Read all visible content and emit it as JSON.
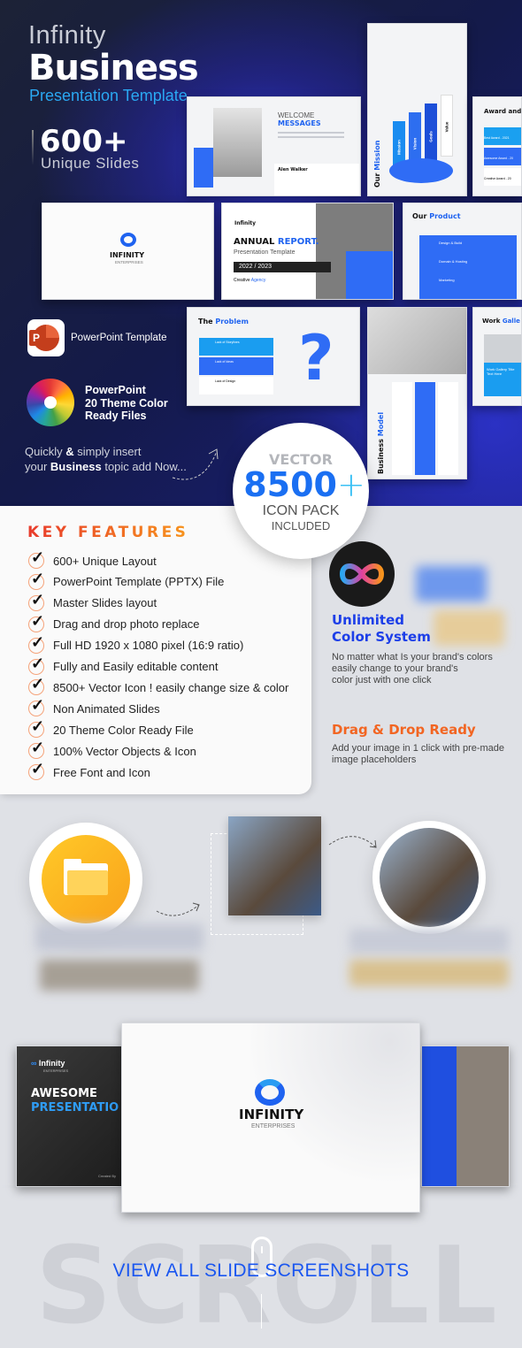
{
  "hero": {
    "brand": "Infinity",
    "title": "Business",
    "subtitle": "Presentation Template.",
    "count": "600+",
    "count_label": "Unique Slides",
    "ppt_label": "PowerPoint Template",
    "theme_label": [
      "PowerPoint",
      "20 Theme Color",
      "Ready Files"
    ],
    "tagline_1_pre": "Quickly ",
    "tagline_1_amp": "&",
    "tagline_1_post": " simply insert",
    "tagline_2_pre": "your ",
    "tagline_2_bold": "Business",
    "tagline_2_post": " topic add Now..."
  },
  "slides": {
    "welcome": {
      "line1": "WELCOME",
      "line2": "MESSAGES",
      "name": "Alen Walker",
      "side": "WELCOME"
    },
    "mission": {
      "title_a": "Our",
      "title_b": "Mission",
      "arrows": [
        "Mission",
        "Vision",
        "Goals",
        "Value"
      ]
    },
    "award": {
      "title": "Award and",
      "items": [
        "Best Award - 2021",
        "Awesome Award - 20",
        "Creative Award - 20"
      ]
    },
    "logo": {
      "name": "INFINITY",
      "sub": "ENTERPRISES"
    },
    "annual": {
      "brand": "Infinity",
      "brand_sub": "ENTERPRISES",
      "title_a": "ANNUAL",
      "title_b": "REPORT.",
      "subtitle": "Presentation Template",
      "years": "2022 / 2023",
      "agency_a": "Creative",
      "agency_b": "Agency"
    },
    "product": {
      "title_a": "Our",
      "title_b": "Product",
      "items": [
        "Design & Build",
        "Domain & Hosting",
        "Marketing"
      ]
    },
    "problem": {
      "title_a": "The",
      "title_b": "Problem",
      "items": [
        "Lack of Storylines",
        "Lack of Ideas",
        "Lack of Design"
      ]
    },
    "business_model": {
      "title_a": "Business",
      "title_b": "Model"
    },
    "gallery": {
      "title_a": "Work",
      "title_b": "Galle",
      "caption": "Work Gallery Title Text Here"
    }
  },
  "vector_badge": {
    "top": "VECTOR",
    "number": "8500",
    "plus": "+",
    "line1": "ICON PACK",
    "line2": "INCLUDED"
  },
  "key_features": {
    "title": "KEY FEATURES",
    "items": [
      "600+ Unique Layout",
      "PowerPoint Template (PPTX) File",
      "Master Slides layout",
      "Drag and drop photo replace",
      "Full HD 1920 x 1080 pixel (16:9 ratio)",
      "Fully and Easily editable content",
      "8500+ Vector Icon ! easily change size & color",
      "Non Animated Slides",
      "20 Theme Color  Ready File",
      "100% Vector Objects & Icon",
      "Free Font and Icon"
    ]
  },
  "color_system": {
    "title_1": "Unlimited",
    "title_2": "Color System",
    "desc": [
      "No matter what Is your brand's colors",
      "easily change to your brand's",
      "color just with one click"
    ]
  },
  "drag_drop": {
    "title": "Drag & Drop Ready",
    "desc": [
      "Add your image in 1 click with pre-made",
      "image placeholders"
    ]
  },
  "bottom": {
    "left_slide": {
      "brand": "Infinity",
      "brand_sub": "ENTERPRISES",
      "title_1": "AWESOME",
      "title_2": "PRESENTATIO",
      "created": "Created By"
    },
    "center_slide": {
      "name": "INFINITY",
      "sub": "ENTERPRISES"
    },
    "scroll_word": "SCROLL",
    "cta": "VIEW ALL SLIDE SCREENSHOTS"
  },
  "colors": {
    "accent_blue": "#1f63f0",
    "cyan": "#2aa8f2",
    "orange": "#f26522",
    "hero_bg": "#141a4a"
  }
}
